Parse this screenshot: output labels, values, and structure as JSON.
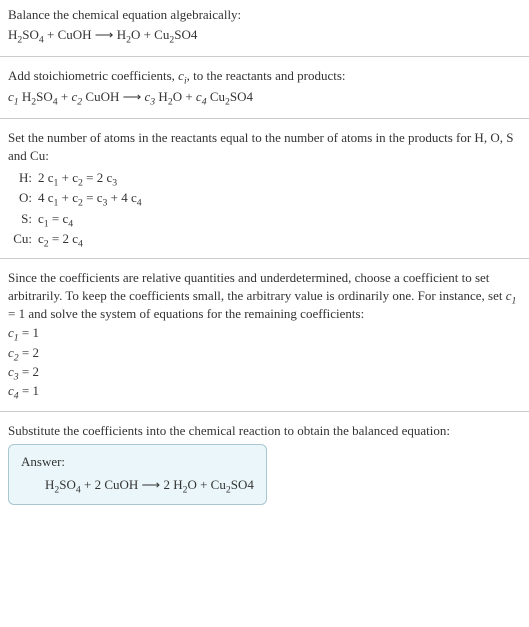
{
  "intro": {
    "line1": "Balance the chemical equation algebraically:",
    "eq_lhs1": "H",
    "eq_lhs2": "SO",
    "eq_plus": " + CuOH ",
    "eq_arrow": "⟶",
    "eq_rhs1": " H",
    "eq_rhs2": "O + Cu",
    "eq_rhs3": "SO4"
  },
  "stoich": {
    "line1a": "Add stoichiometric coefficients, ",
    "ci": "c",
    "ci_sub": "i",
    "line1b": ", to the reactants and products:",
    "c1": "c",
    "c1s": "1",
    "sp1": " H",
    "h2": "2",
    "so4": "SO",
    "so4s": "4",
    "plus1": " + ",
    "c2": "c",
    "c2s": "2",
    "sp2": " CuOH ",
    "arrow": "⟶ ",
    "c3": "c",
    "c3s": "3",
    "sp3": " H",
    "h2o2": "2",
    "o": "O + ",
    "c4": "c",
    "c4s": "4",
    "sp4": " Cu",
    "cu2": "2",
    "so4b": "SO4"
  },
  "atoms": {
    "intro": "Set the number of atoms in the reactants equal to the number of atoms in the products for H, O, S and Cu:",
    "rows": [
      {
        "label": "H:",
        "lhs_a": "2 c",
        "lhs_as": "1",
        "plus": " + c",
        "lhs_bs": "2",
        "eq": " = 2 c",
        "rhs_s": "3"
      },
      {
        "label": "O:",
        "lhs_a": "4 c",
        "lhs_as": "1",
        "plus": " + c",
        "lhs_bs": "2",
        "eq": " = c",
        "mid_s": "3",
        "plus2": " + 4 c",
        "rhs_s": "4"
      },
      {
        "label": "S:",
        "lhs_a": "c",
        "lhs_as": "1",
        "eq": " = c",
        "rhs_s": "4"
      },
      {
        "label": "Cu:",
        "lhs_a": "c",
        "lhs_as": "2",
        "eq": " = 2 c",
        "rhs_s": "4"
      }
    ]
  },
  "solve": {
    "para_a": "Since the coefficients are relative quantities and underdetermined, choose a coefficient to set arbitrarily. To keep the coefficients small, the arbitrary value is ordinarily one. For instance, set ",
    "c1": "c",
    "c1s": "1",
    "para_b": " = 1 and solve the system of equations for the remaining coefficients:",
    "coeffs": [
      {
        "c": "c",
        "s": "1",
        "v": " = 1"
      },
      {
        "c": "c",
        "s": "2",
        "v": " = 2"
      },
      {
        "c": "c",
        "s": "3",
        "v": " = 2"
      },
      {
        "c": "c",
        "s": "4",
        "v": " = 1"
      }
    ]
  },
  "final": {
    "intro": "Substitute the coefficients into the chemical reaction to obtain the balanced equation:",
    "answer_label": "Answer:",
    "eq_a": "H",
    "eq_as": "2",
    "eq_b": "SO",
    "eq_bs": "4",
    "eq_c": " + 2 CuOH ",
    "arrow": "⟶",
    "eq_d": " 2 H",
    "eq_ds": "2",
    "eq_e": "O + Cu",
    "eq_es": "2",
    "eq_f": "SO4"
  }
}
